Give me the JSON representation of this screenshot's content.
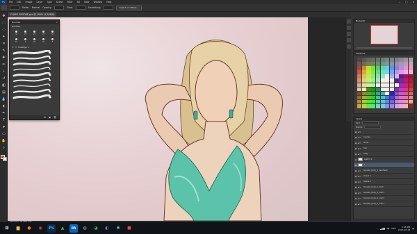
{
  "app": {
    "logo": "Ps",
    "menu": [
      "File",
      "Edit",
      "Image",
      "Layer",
      "Type",
      "Select",
      "Filter",
      "3D",
      "View",
      "Window",
      "Help"
    ]
  },
  "options_bar": {
    "tool_icon": "brush-icon",
    "brush_label": "Mode:",
    "mode_value": "Normal",
    "opacity_label": "Opacity:",
    "flow_label": "Flow:",
    "smoothing_label": "Smoothing:",
    "select_mask_button": "Select and Mask..."
  },
  "document": {
    "tab_title": "CHASE FUSIONE.psd @ 100% (1 RGB/8)"
  },
  "status": {
    "zoom_doc": "100%   Doc: 26.4M/1.34G"
  },
  "brush_panel": {
    "title": "Brushes",
    "close": "×",
    "tab_label": "Brushes",
    "sizes": [
      "30",
      "25",
      "25",
      "25",
      "30",
      "15",
      "5",
      "20",
      "20",
      "5"
    ],
    "folder_label": "Feelings 1",
    "footer_icons": [
      "brush-settings-icon",
      "new-folder-icon",
      "delete-icon"
    ]
  },
  "right_panels": {
    "navigator_title": "Navigator",
    "swatches_title": "Swatches",
    "layers_title": "Layers",
    "layers_filter": "Kind",
    "layers_blend": "Normal",
    "layers": [
      {
        "name": "",
        "type": "folder",
        "sel": false
      },
      {
        "name": "overlay",
        "type": "folder",
        "sel": false
      },
      {
        "name": "shine",
        "type": "folder",
        "sel": false
      },
      {
        "name": "hair",
        "type": "folder",
        "sel": false
      },
      {
        "name": "body",
        "type": "folder",
        "sel": false
      },
      {
        "name": "sketch_2",
        "type": "layer",
        "sel": false
      },
      {
        "name": "1",
        "type": "layer",
        "sel": true
      },
      {
        "name": "tsunako_body_b_overhead",
        "type": "folder",
        "sel": false
      },
      {
        "name": "sleeve 1",
        "type": "folder",
        "sel": false
      },
      {
        "name": "sleeve 2",
        "type": "folder",
        "sel": false
      },
      {
        "name": "tsunako_body_b_clock",
        "type": "folder",
        "sel": false
      },
      {
        "name": "tsunako_body_b_undr1",
        "type": "folder",
        "sel": false
      },
      {
        "name": "tsunako_body_b_undr2",
        "type": "folder",
        "sel": false
      },
      {
        "name": "tsunako_body_b_undr3",
        "type": "folder",
        "sel": false
      }
    ]
  },
  "taskbar": {
    "apps": [
      {
        "icon": "windows-icon",
        "glyph": "⊞",
        "bg": "#101418",
        "fg": "#ffffff"
      },
      {
        "icon": "folder-icon",
        "glyph": "▆",
        "bg": "#101418",
        "fg": "#f2c14e"
      },
      {
        "icon": "firefox-icon",
        "glyph": "●",
        "bg": "#101418",
        "fg": "#ff7a1a"
      },
      {
        "icon": "chrome-icon",
        "glyph": "◉",
        "bg": "#101418",
        "fg": "#e8453c"
      },
      {
        "icon": "photoshop-icon",
        "glyph": "Ps",
        "bg": "#0f2a44",
        "fg": "#31a8ff"
      },
      {
        "icon": "maps-icon",
        "glyph": "▲",
        "bg": "#101418",
        "fg": "#4caf50"
      },
      {
        "icon": "linkedin-icon",
        "glyph": "in",
        "bg": "#0a66c2",
        "fg": "#ffffff"
      },
      {
        "icon": "steam-icon",
        "glyph": "◍",
        "bg": "#101418",
        "fg": "#9fb3c8"
      },
      {
        "icon": "spotify-icon",
        "glyph": "◕",
        "bg": "#101418",
        "fg": "#1db954"
      },
      {
        "icon": "discord-icon",
        "glyph": "◐",
        "bg": "#101418",
        "fg": "#7289da"
      },
      {
        "icon": "settings-icon",
        "glyph": "✱",
        "bg": "#101418",
        "fg": "#4cc2ff"
      },
      {
        "icon": "app-icon",
        "glyph": "■",
        "bg": "#101418",
        "fg": "#d94f4f"
      }
    ],
    "lang": "ENG",
    "time": "2:46 PM",
    "date": "2020-06-28"
  }
}
